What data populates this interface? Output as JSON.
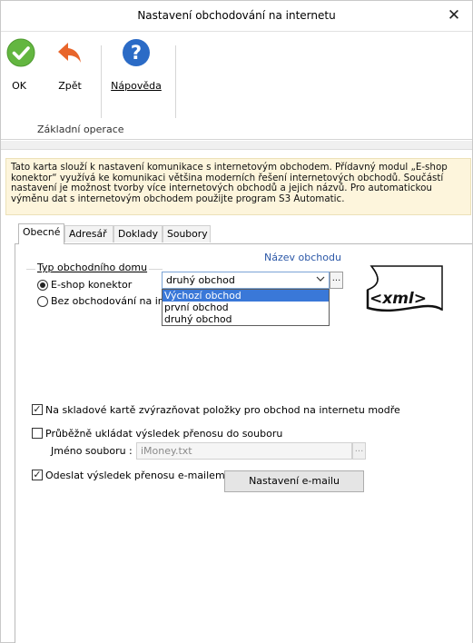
{
  "window": {
    "title": "Nastavení obchodování na internetu",
    "close_glyph": "✕"
  },
  "ribbon": {
    "buttons": [
      {
        "label": "OK",
        "icon": "ok-check-icon"
      },
      {
        "label": "Zpět",
        "icon": "back-arrow-icon"
      },
      {
        "label": "Nápověda",
        "icon": "help-icon"
      }
    ],
    "group_label": "Základní operace"
  },
  "info_text": "Tato karta slouží k nastavení komunikace s internetovým obchodem. Přídavný modul „E-shop konektor“ využívá ke komunikaci většina moderních řešení internetových obchodů. Součástí nastavení je možnost tvorby více internetových obchodů a jejich názvů. Pro automatickou výměnu dat s internetovým obchodem použijte program S3 Automatic.",
  "tabs": [
    {
      "label": "Obecné",
      "active": true
    },
    {
      "label": "Adresář",
      "active": false
    },
    {
      "label": "Doklady",
      "active": false
    },
    {
      "label": "Soubory",
      "active": false
    }
  ],
  "general": {
    "shop_name_label": "Název obchodu",
    "shop_type_group": "Typ obchodního domu",
    "radio_eshop": "E-shop konektor",
    "radio_none": "Bez obchodování na internetu",
    "radio_none_visible": "Bez obchodování na inte",
    "shop_combo_value": "druhý obchod",
    "shop_options": [
      "Výchozí obchod",
      "první obchod",
      "druhý obchod"
    ],
    "dots": "...",
    "xml_logo_text": "<xml>",
    "highlight_check": "Na skladové kartě zvýrazňovat položky pro obchod na internetu modře",
    "save_check": "Průběžně ukládat výsledek přenosu do souboru",
    "file_label": "Jméno souboru :",
    "file_value": "iMoney.txt",
    "email_check": "Odeslat výsledek přenosu e-mailem",
    "email_button": "Nastavení e-mailu"
  },
  "colors": {
    "accent": "#2b57a7",
    "selection": "#3a78d8",
    "info_bg": "#fdf5dc"
  }
}
